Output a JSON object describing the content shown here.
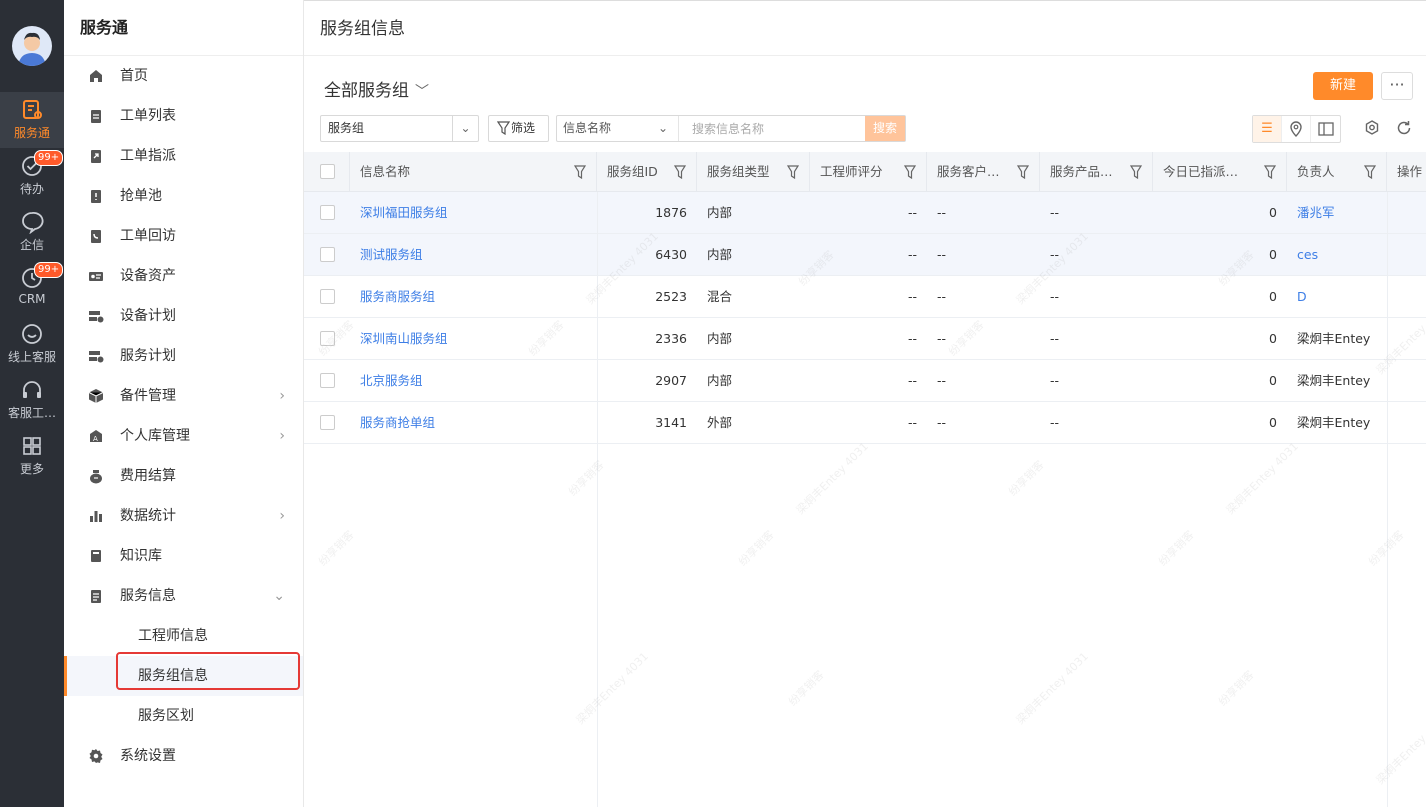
{
  "rail": {
    "items": [
      {
        "label": "服务通",
        "icon": "service-icon"
      },
      {
        "label": "待办",
        "icon": "todo-check-icon",
        "badge": "99+"
      },
      {
        "label": "企信",
        "icon": "chat-bubble-icon"
      },
      {
        "label": "CRM",
        "icon": "crm-clock-icon",
        "badge": "99+"
      },
      {
        "label": "线上客服",
        "icon": "smile-chat-icon"
      },
      {
        "label": "客服工…",
        "icon": "headset-icon"
      },
      {
        "label": "更多",
        "icon": "grid-icon"
      }
    ]
  },
  "sidebar": {
    "title": "服务通",
    "items": [
      {
        "label": "首页",
        "icon": "home-icon"
      },
      {
        "label": "工单列表",
        "icon": "clipboard-icon"
      },
      {
        "label": "工单指派",
        "icon": "assign-icon"
      },
      {
        "label": "抢单池",
        "icon": "grab-pool-icon"
      },
      {
        "label": "工单回访",
        "icon": "callback-icon"
      },
      {
        "label": "设备资产",
        "icon": "device-asset-icon"
      },
      {
        "label": "设备计划",
        "icon": "device-plan-icon"
      },
      {
        "label": "服务计划",
        "icon": "service-plan-icon"
      },
      {
        "label": "备件管理",
        "icon": "parts-box-icon",
        "chevron": "›"
      },
      {
        "label": "个人库管理",
        "icon": "personal-store-icon",
        "chevron": "›"
      },
      {
        "label": "费用结算",
        "icon": "money-bag-icon"
      },
      {
        "label": "数据统计",
        "icon": "bar-chart-icon",
        "chevron": "›"
      },
      {
        "label": "知识库",
        "icon": "book-icon"
      },
      {
        "label": "服务信息",
        "icon": "info-doc-icon",
        "chevron": "⌄"
      }
    ],
    "sub_items": [
      {
        "label": "工程师信息"
      },
      {
        "label": "服务组信息"
      },
      {
        "label": "服务区划"
      }
    ],
    "settings": {
      "label": "系统设置",
      "icon": "gear-icon"
    }
  },
  "topbar": {
    "title": "服务组信息"
  },
  "view": {
    "title": "全部服务组",
    "caret": "﹀"
  },
  "toolbar": {
    "new_label": "新建",
    "more_label": "···",
    "object_select": "服务组",
    "filter_label": "筛选",
    "search_field": "信息名称",
    "search_placeholder": "搜索信息名称",
    "search_button": "搜索"
  },
  "colors": {
    "accent": "#ff8a2a",
    "link": "#3d7ee6",
    "rail_bg": "#2b2f36",
    "badge": "#ff5a2a"
  },
  "table": {
    "columns": [
      "信息名称",
      "服务组ID",
      "服务组类型",
      "工程师评分",
      "服务客户…",
      "服务产品…",
      "今日已指派…",
      "负责人",
      "操作"
    ],
    "rows": [
      {
        "name": "深圳福田服务组",
        "id": "1876",
        "type": "内部",
        "score": "--",
        "customer": "--",
        "product": "--",
        "today": "0",
        "owner": "潘兆军",
        "owner_link": true
      },
      {
        "name": "测试服务组",
        "id": "6430",
        "type": "内部",
        "score": "--",
        "customer": "--",
        "product": "--",
        "today": "0",
        "owner": "ces",
        "owner_link": true
      },
      {
        "name": "服务商服务组",
        "id": "2523",
        "type": "混合",
        "score": "--",
        "customer": "--",
        "product": "--",
        "today": "0",
        "owner": "D",
        "owner_link": true
      },
      {
        "name": "深圳南山服务组",
        "id": "2336",
        "type": "内部",
        "score": "--",
        "customer": "--",
        "product": "--",
        "today": "0",
        "owner": "梁炯丰Entey",
        "owner_link": false
      },
      {
        "name": "北京服务组",
        "id": "2907",
        "type": "内部",
        "score": "--",
        "customer": "--",
        "product": "--",
        "today": "0",
        "owner": "梁炯丰Entey",
        "owner_link": false
      },
      {
        "name": "服务商抢单组",
        "id": "3141",
        "type": "外部",
        "score": "--",
        "customer": "--",
        "product": "--",
        "today": "0",
        "owner": "梁炯丰Entey",
        "owner_link": false
      }
    ]
  },
  "watermarks": [
    "梁炯丰Entey 4031",
    "纷享销客"
  ]
}
